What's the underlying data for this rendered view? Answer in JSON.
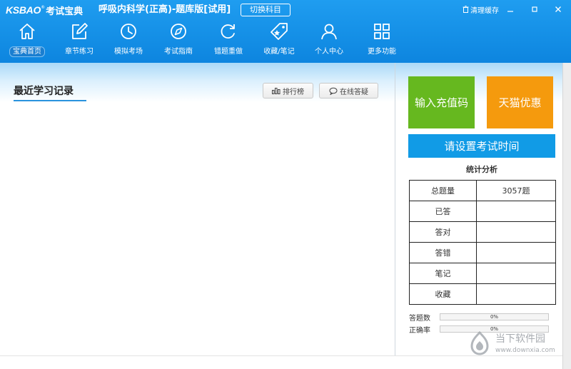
{
  "header": {
    "logo_text": "KSBAO",
    "logo_reg": "®",
    "logo_cn": "考试宝典",
    "app_title": "呼吸内科学(正高)-题库版[试用]",
    "switch_subject_label": "切换科目",
    "clear_cache_label": "清理缓存"
  },
  "nav": [
    {
      "label": "宝典首页",
      "icon": "home-icon",
      "active": true
    },
    {
      "label": "章节练习",
      "icon": "edit-icon",
      "active": false
    },
    {
      "label": "模拟考场",
      "icon": "clock-icon",
      "active": false
    },
    {
      "label": "考试指南",
      "icon": "compass-icon",
      "active": false
    },
    {
      "label": "错题重做",
      "icon": "refresh-icon",
      "active": false
    },
    {
      "label": "收藏/笔记",
      "icon": "tag-icon",
      "active": false
    },
    {
      "label": "个人中心",
      "icon": "user-icon",
      "active": false
    },
    {
      "label": "更多功能",
      "icon": "grid-icon",
      "active": false
    }
  ],
  "main": {
    "section_title": "最近学习记录",
    "ranking_label": "排行榜",
    "online_qa_label": "在线答疑"
  },
  "sidebar": {
    "recharge_label": "输入充值码",
    "tmall_label": "天猫优惠",
    "exam_time_label": "请设置考试时间",
    "stats_title": "统计分析",
    "stats": [
      {
        "label": "总题量",
        "value": "3057题"
      },
      {
        "label": "已答",
        "value": ""
      },
      {
        "label": "答对",
        "value": ""
      },
      {
        "label": "答错",
        "value": ""
      },
      {
        "label": "笔记",
        "value": ""
      },
      {
        "label": "收藏",
        "value": ""
      }
    ],
    "progress": [
      {
        "label": "答题数",
        "text": "0%",
        "value": 0
      },
      {
        "label": "正确率",
        "text": "0%",
        "value": 0
      }
    ]
  },
  "watermark": {
    "cn": "当下软件园",
    "url": "www.downxia.com"
  },
  "colors": {
    "header_blue": "#1891e8",
    "tile_green": "#66b81f",
    "tile_orange": "#f59a0d",
    "button_blue": "#119be6"
  }
}
